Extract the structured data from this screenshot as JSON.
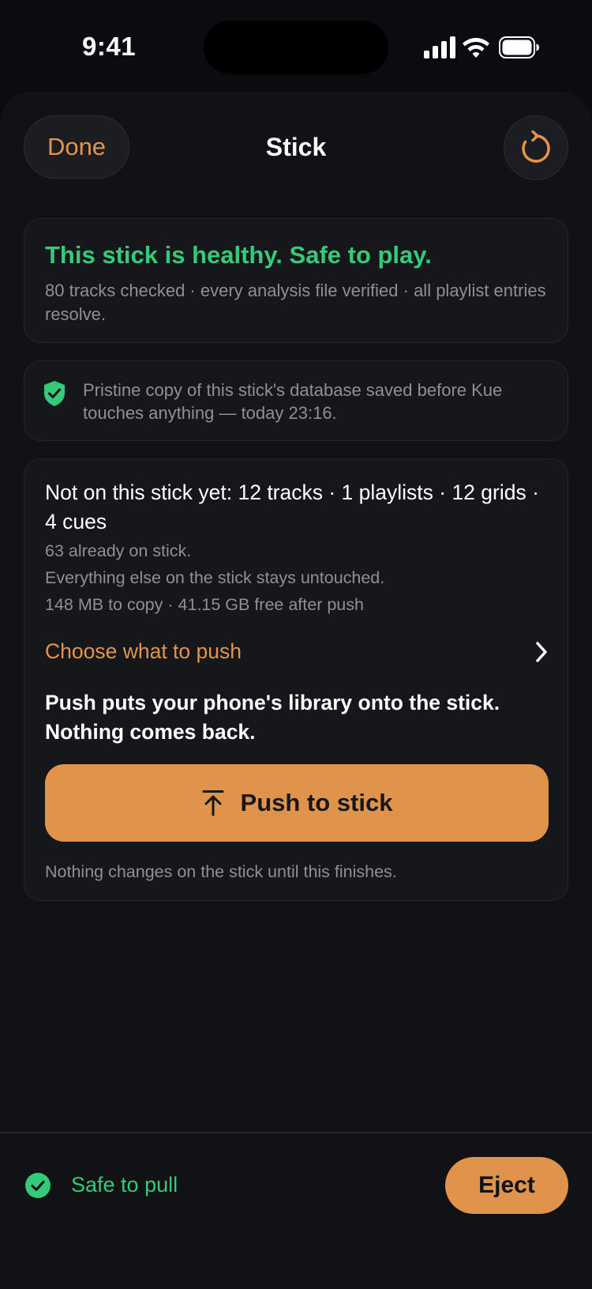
{
  "status_bar": {
    "time": "9:41",
    "icons": [
      "cellular-signal-icon",
      "wifi-icon",
      "battery-icon"
    ]
  },
  "nav": {
    "done_label": "Done",
    "title": "Stick",
    "refresh_icon": "refresh-icon"
  },
  "health": {
    "title": "This stick is healthy. Safe to play.",
    "subtitle": "80 tracks checked · every analysis file verified · all playlist entries resolve."
  },
  "backup": {
    "icon": "shield-check-icon",
    "text": "Pristine copy of this stick's database saved before Kue touches anything — today 23:16."
  },
  "push": {
    "heading": "Not on this stick yet: 12 tracks · 1 playlists · 12 grids · 4 cues",
    "already": "63 already on stick.",
    "untouched": "Everything else on the stick stays untouched.",
    "size": "148 MB to copy · 41.15 GB free after push",
    "choose_label": "Choose what to push",
    "explain": "Push puts your phone's library onto the stick. Nothing comes back.",
    "button_label": "Push to stick",
    "button_icon": "upload-arrow-icon",
    "footnote": "Nothing changes on the stick until this finishes."
  },
  "bottom": {
    "safe_label": "Safe to pull",
    "eject_label": "Eject"
  },
  "colors": {
    "accent": "#e0934a",
    "success": "#35c97a",
    "background": "#0b0c0f",
    "card": "#16171b",
    "muted_text": "#8e9098"
  }
}
